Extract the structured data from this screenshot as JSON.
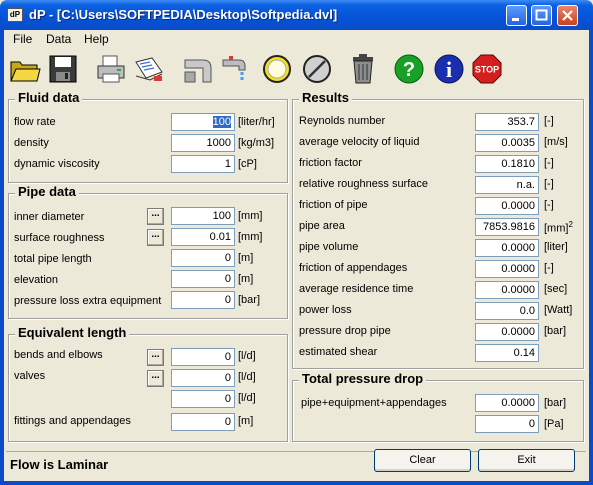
{
  "window": {
    "title": "dP - [C:\\Users\\SOFTPEDIA\\Desktop\\Softpedia.dvl]",
    "app_icon_text": "dP"
  },
  "menu": [
    "File",
    "Data",
    "Help"
  ],
  "toolbar": {
    "icons": [
      "open-folder",
      "save-disk",
      "printer",
      "print-preview",
      "pipes",
      "faucet",
      "yellow-circle",
      "no-sign",
      "trash-can",
      "help-question",
      "info",
      "stop-sign"
    ],
    "stop_label": "STOP"
  },
  "fluid": {
    "title": "Fluid data",
    "rows": [
      {
        "label": "flow rate",
        "value": "100",
        "unit": "[liter/hr]"
      },
      {
        "label": "density",
        "value": "1000",
        "unit": "[kg/m3]"
      },
      {
        "label": "dynamic viscosity",
        "value": "1",
        "unit": "[cP]"
      }
    ]
  },
  "pipe": {
    "title": "Pipe data",
    "rows": [
      {
        "label": "inner diameter",
        "value": "100",
        "unit": "[mm]"
      },
      {
        "label": "surface roughness",
        "value": "0.01",
        "unit": "[mm]"
      },
      {
        "label": "total pipe length",
        "value": "0",
        "unit": "[m]"
      },
      {
        "label": "elevation",
        "value": "0",
        "unit": "[m]"
      },
      {
        "label": "pressure loss extra equipment",
        "value": "0",
        "unit": "[bar]"
      }
    ],
    "browse_label": "..."
  },
  "equiv": {
    "title": "Equivalent length",
    "rows": [
      {
        "label": "bends and elbows",
        "value": "0",
        "unit": "[l/d]"
      },
      {
        "label": "valves",
        "value": "0",
        "unit": "[l/d]"
      },
      {
        "label": "",
        "value": "0",
        "unit": "[l/d]"
      },
      {
        "label": "fittings and appendages",
        "value": "0",
        "unit": "[m]"
      }
    ]
  },
  "results": {
    "title": "Results",
    "rows": [
      {
        "label": "Reynolds number",
        "value": "353.7",
        "unit": "[-]"
      },
      {
        "label": "average velocity of liquid",
        "value": "0.0035",
        "unit": "[m/s]"
      },
      {
        "label": "friction factor",
        "value": "0.1810",
        "unit": "[-]"
      },
      {
        "label": "relative roughness surface",
        "value": "n.a.",
        "unit": "[-]"
      },
      {
        "label": "friction of pipe",
        "value": "0.0000",
        "unit": "[-]"
      },
      {
        "label": "pipe area",
        "value": "7853.9816",
        "unit": "[mm]",
        "sup": "2"
      },
      {
        "label": "pipe volume",
        "value": "0.0000",
        "unit": "[liter]"
      },
      {
        "label": "friction of appendages",
        "value": "0.0000",
        "unit": "[-]"
      },
      {
        "label": "average residence time",
        "value": "0.0000",
        "unit": "[sec]"
      },
      {
        "label": "power loss",
        "value": "0.0",
        "unit": "[Watt]"
      },
      {
        "label": "pressure drop pipe",
        "value": "0.0000",
        "unit": "[bar]"
      },
      {
        "label": "estimated shear",
        "value": "0.14",
        "unit": ""
      }
    ]
  },
  "total": {
    "title": "Total pressure drop",
    "label": "pipe+equipment+appendages",
    "value_bar": "0.0000",
    "unit_bar": "[bar]",
    "value_pa": "0",
    "unit_pa": "[Pa]"
  },
  "status": {
    "text": "Flow is Laminar",
    "clear_label": "Clear",
    "exit_label": "Exit"
  }
}
